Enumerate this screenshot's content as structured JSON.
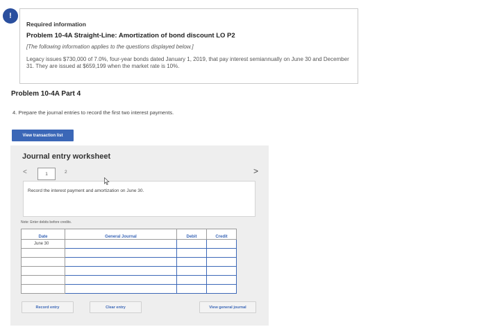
{
  "info": {
    "badge_glyph": "!",
    "required_label": "Required information",
    "problem_title": "Problem 10-4A Straight-Line: Amortization of bond discount LO P2",
    "follow_note": "[The following information applies to the questions displayed below.]",
    "description": "Legacy issues $730,000 of 7.0%, four-year bonds dated January 1, 2019, that pay interest semiannually on June 30 and December 31. They are issued at $659,199 when the market rate is 10%."
  },
  "part_title": "Problem 10-4A Part 4",
  "question": "4. Prepare the journal entries to record the first two interest payments.",
  "view_transaction_btn": "View transaction list",
  "worksheet": {
    "title": "Journal entry worksheet",
    "prev_glyph": "<",
    "next_glyph": ">",
    "pages": [
      "1",
      "2"
    ],
    "instruction": "Record the interest payment and amortization on June 30.",
    "note": "Note: Enter debits before credits.",
    "columns": [
      "Date",
      "General Journal",
      "Debit",
      "Credit"
    ],
    "date_value": "June 30",
    "buttons": {
      "record": "Record entry",
      "clear": "Clear entry",
      "view_journal": "View general journal"
    }
  },
  "colors": {
    "accent": "#3b67b7",
    "badge": "#2a4f9e"
  }
}
